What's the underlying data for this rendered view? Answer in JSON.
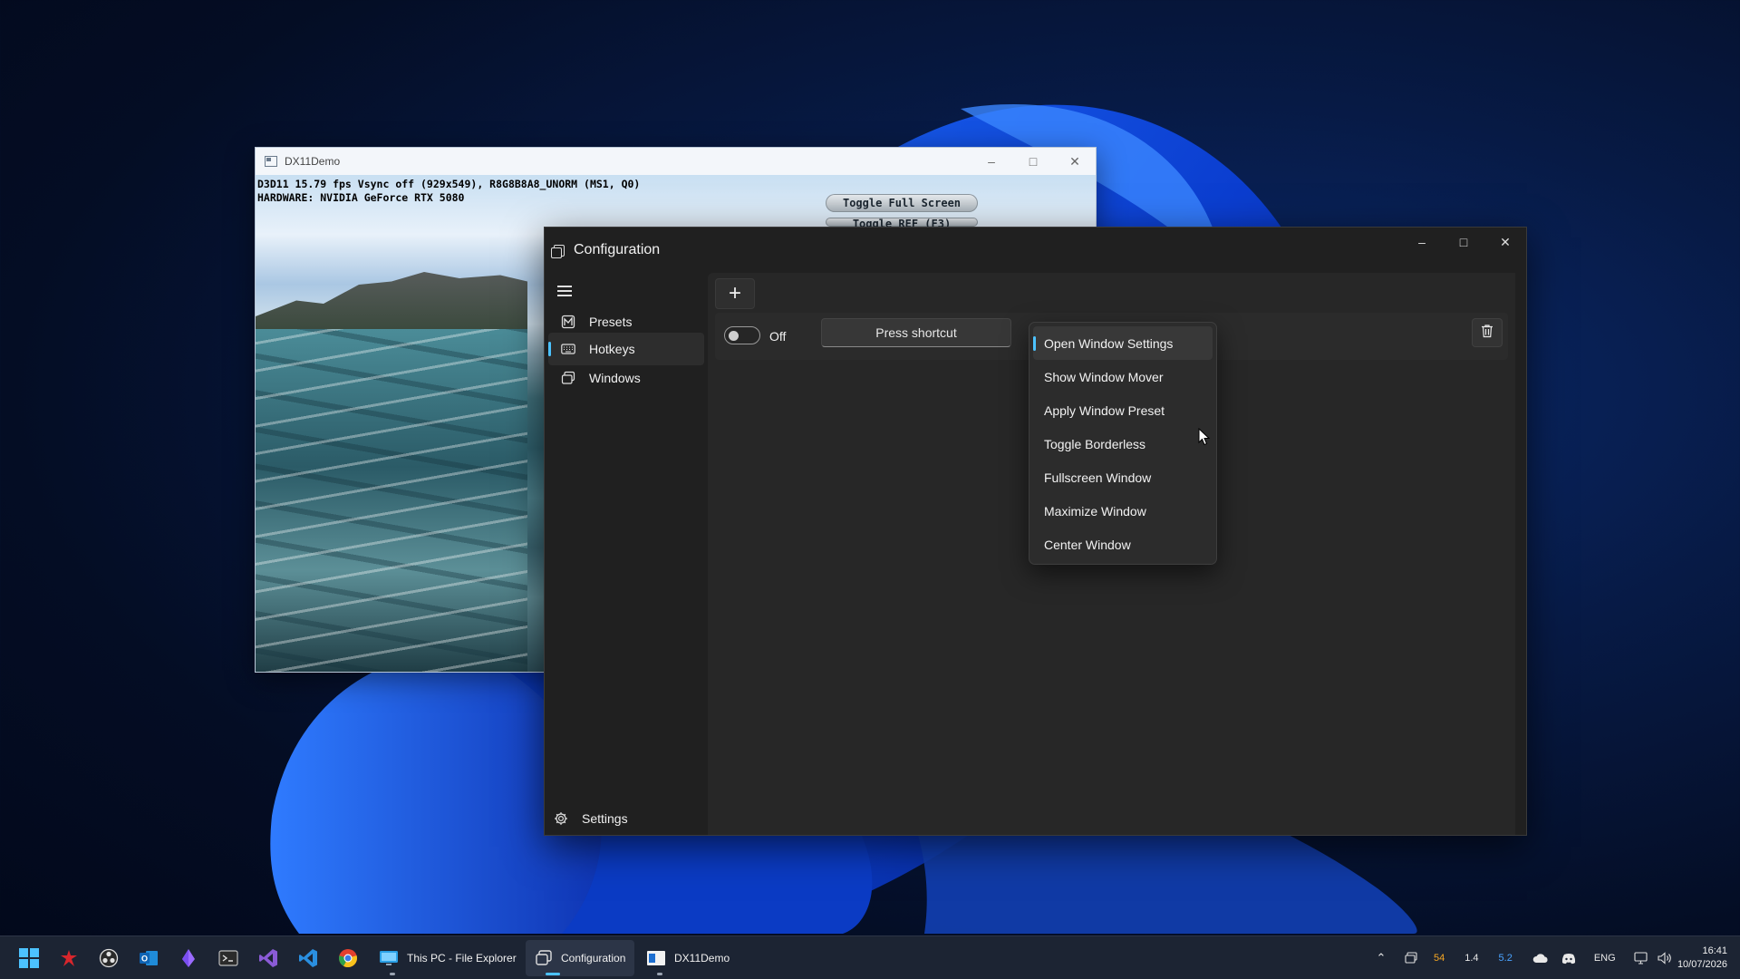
{
  "dx_window": {
    "title": "DX11Demo",
    "overlay_line1": "D3D11 15.79 fps Vsync off (929x549), R8G8B8A8_UNORM (MS1, Q0)",
    "overlay_line2": "HARDWARE: NVIDIA GeForce RTX 5080",
    "button1": "Toggle Full Screen",
    "button2": "Toggle REF (F3)"
  },
  "config_window": {
    "title": "Configuration",
    "nav": [
      {
        "label": "Presets",
        "icon": "presets-icon"
      },
      {
        "label": "Hotkeys",
        "icon": "keyboard-icon",
        "active": true
      },
      {
        "label": "Windows",
        "icon": "windows-icon"
      }
    ],
    "settings_label": "Settings",
    "hotkey_row": {
      "toggle_state": "Off",
      "shortcut_label": "Press shortcut"
    }
  },
  "action_menu": {
    "items": [
      "Open Window Settings",
      "Show Window Mover",
      "Apply Window Preset",
      "Toggle Borderless",
      "Fullscreen Window",
      "Maximize Window",
      "Center Window"
    ],
    "selected": "Open Window Settings"
  },
  "taskbar": {
    "apps": [
      {
        "label": "This PC - File Explorer"
      },
      {
        "label": "Configuration",
        "active": true
      },
      {
        "label": "DX11Demo"
      }
    ],
    "tray": {
      "val1": "54",
      "val2": "1.4",
      "val3": "5.2",
      "lang": "ENG"
    },
    "time": "16:41",
    "date": "10/07/2026"
  },
  "colors": {
    "accent": "#4cc2ff",
    "tray_val1": "#f5a623",
    "tray_val3": "#4aa3ff"
  }
}
